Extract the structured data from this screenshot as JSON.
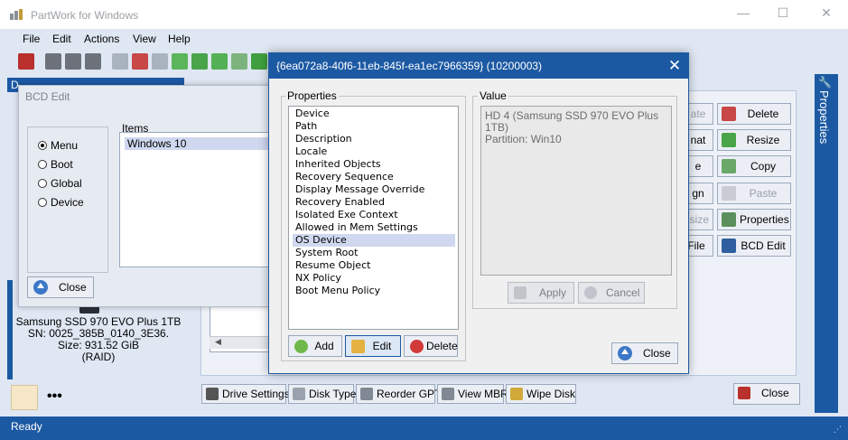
{
  "window": {
    "title": "PartWork for Windows",
    "minimize_glyph": "—",
    "maximize_glyph": "☐",
    "close_glyph": "✕"
  },
  "menu": [
    "File",
    "Edit",
    "Actions",
    "View",
    "Help"
  ],
  "toolbar_icons": [
    "exit-icon",
    "print-preview-icon",
    "print-setup-icon",
    "print-icon",
    "add-disk-icon",
    "delete-disk-icon",
    "format-disk-icon",
    "disk-icon",
    "disk-green-icon",
    "move-disk-icon",
    "copy-disk-icon",
    "resize-disk-icon"
  ],
  "left_pane": {
    "tab_fragment": "D",
    "drive": {
      "model": "Samsung SSD 970 EVO Plus 1TB",
      "sn": "SN: 0025_385B_0140_3E36.",
      "size": "Size: 931.52 GiB",
      "type": "(RAID)"
    },
    "more_label": "•••"
  },
  "right_buttons": [
    {
      "label": "ate",
      "enabled": false
    },
    {
      "label": "Delete",
      "enabled": true
    },
    {
      "label": "nat",
      "enabled": true
    },
    {
      "label": "Resize",
      "enabled": true
    },
    {
      "label": "e",
      "enabled": true
    },
    {
      "label": "Copy",
      "enabled": true
    },
    {
      "label": "gn",
      "enabled": true
    },
    {
      "label": "Paste",
      "enabled": false
    },
    {
      "label": "esize",
      "enabled": false
    },
    {
      "label": "Properties",
      "enabled": true
    },
    {
      "label": "File",
      "enabled": true
    },
    {
      "label": "BCD Edit",
      "enabled": true
    }
  ],
  "properties_tab": "Properties",
  "bottom_buttons": [
    "Drive Settings",
    "Disk Type",
    "Reorder GPT",
    "View MBR",
    "Wipe Disk"
  ],
  "bottom_close": "Close",
  "status": "Ready",
  "bcd_dialog": {
    "title": "BCD Edit",
    "radios": [
      {
        "label": "Menu",
        "checked": true
      },
      {
        "label": "Boot",
        "checked": false
      },
      {
        "label": "Global",
        "checked": false
      },
      {
        "label": "Device",
        "checked": false
      }
    ],
    "items_label": "Items",
    "items": [
      "Windows 10"
    ],
    "close_label": "Close"
  },
  "guid_dialog": {
    "title": "{6ea072a8-40f6-11eb-845f-ea1ec7966359} (10200003)",
    "properties_label": "Properties",
    "properties": [
      "Device",
      "Path",
      "Description",
      "Locale",
      "Inherited Objects",
      "Recovery Sequence",
      "Display Message Override",
      "Recovery Enabled",
      "Isolated Exe Context",
      "Allowed in Mem Settings",
      "OS Device",
      "System Root",
      "Resume Object",
      "NX Policy",
      "Boot Menu Policy"
    ],
    "selected_index": 10,
    "add_label": "Add",
    "edit_label": "Edit",
    "delete_label": "Delete",
    "value_label": "Value",
    "value_lines": [
      "HD 4 (Samsung SSD 970 EVO Plus 1TB)",
      "Partition: Win10"
    ],
    "apply_label": "Apply",
    "cancel_label": "Cancel",
    "close_label": "Close",
    "close_glyph": "✕"
  },
  "colors": {
    "accent": "#1c59a3",
    "selection": "#cfd8ef",
    "background": "#dfe7f3"
  }
}
